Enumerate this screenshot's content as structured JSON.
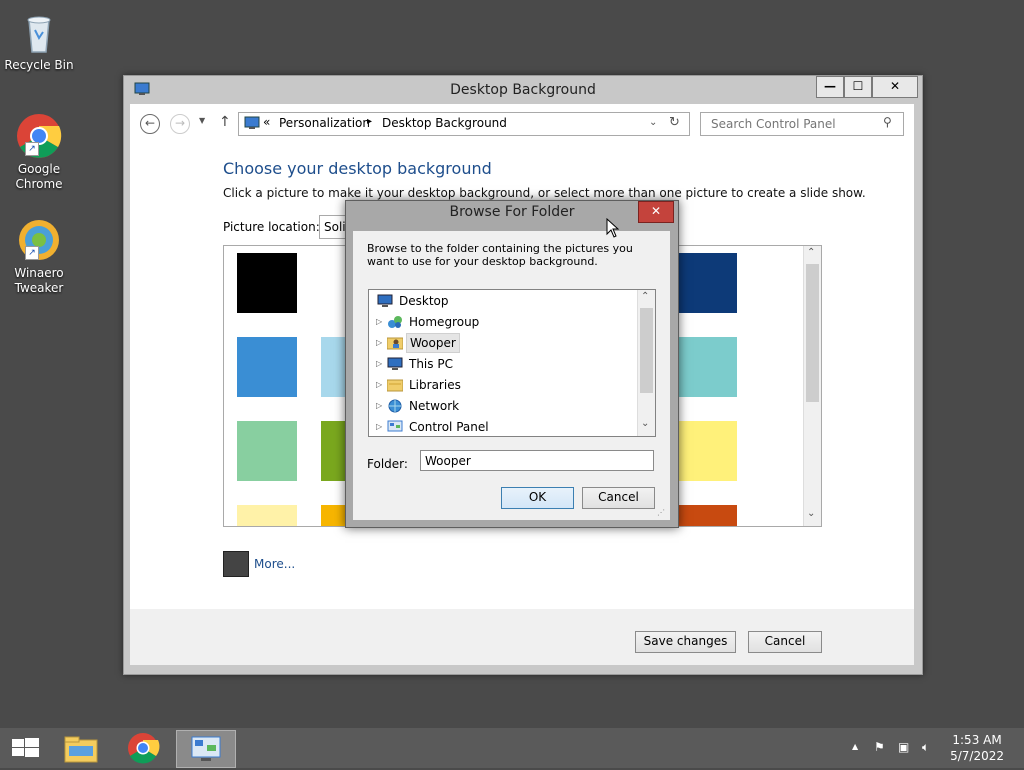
{
  "desktop": {
    "icons": [
      {
        "label_line1": "Recycle Bin",
        "label_line2": ""
      },
      {
        "label_line1": "Google",
        "label_line2": "Chrome"
      },
      {
        "label_line1": "Winaero",
        "label_line2": "Tweaker"
      }
    ]
  },
  "main_window": {
    "title": "Desktop Background",
    "minimize_label": "—",
    "maximize_label": "☐",
    "close_label": "✕",
    "address": {
      "prefix": "«",
      "crumbs": [
        "Personalization",
        "Desktop Background"
      ],
      "separator": "▸"
    },
    "search_placeholder": "Search Control Panel",
    "heading": "Choose your desktop background",
    "instruction": "Click a picture to make it your desktop background, or select more than one picture to create a slide show.",
    "picture_location_label": "Picture location:",
    "picture_location_value": "Solid colors",
    "more_label": "More...",
    "save_label": "Save changes",
    "cancel_label": "Cancel",
    "swatch_colors": {
      "black": "#000000",
      "navy": "#0d3a78",
      "blue": "#3a8ed4",
      "light_blue": "#a8d8ec",
      "teal": "#7ccccc",
      "mint": "#88cfa0",
      "green": "#7aa81e",
      "yellow": "#fff17a",
      "pale_yellow": "#fff2a8",
      "orange": "#f7b500",
      "rust": "#c84a10"
    },
    "more_swatch_color": "#444444"
  },
  "dialog": {
    "title": "Browse For Folder",
    "close_label": "✕",
    "description": "Browse to the folder containing the pictures you want to use for your desktop background.",
    "tree": [
      {
        "label": "Desktop",
        "expandable": false,
        "selected": false
      },
      {
        "label": "Homegroup",
        "expandable": true,
        "selected": false
      },
      {
        "label": "Wooper",
        "expandable": true,
        "selected": true
      },
      {
        "label": "This PC",
        "expandable": true,
        "selected": false
      },
      {
        "label": "Libraries",
        "expandable": true,
        "selected": false
      },
      {
        "label": "Network",
        "expandable": true,
        "selected": false
      },
      {
        "label": "Control Panel",
        "expandable": true,
        "selected": false
      }
    ],
    "folder_label": "Folder:",
    "folder_value": "Wooper",
    "ok_label": "OK",
    "cancel_label": "Cancel"
  },
  "taskbar": {
    "time": "1:53 AM",
    "date": "5/7/2022",
    "up_arrow": "▲"
  }
}
